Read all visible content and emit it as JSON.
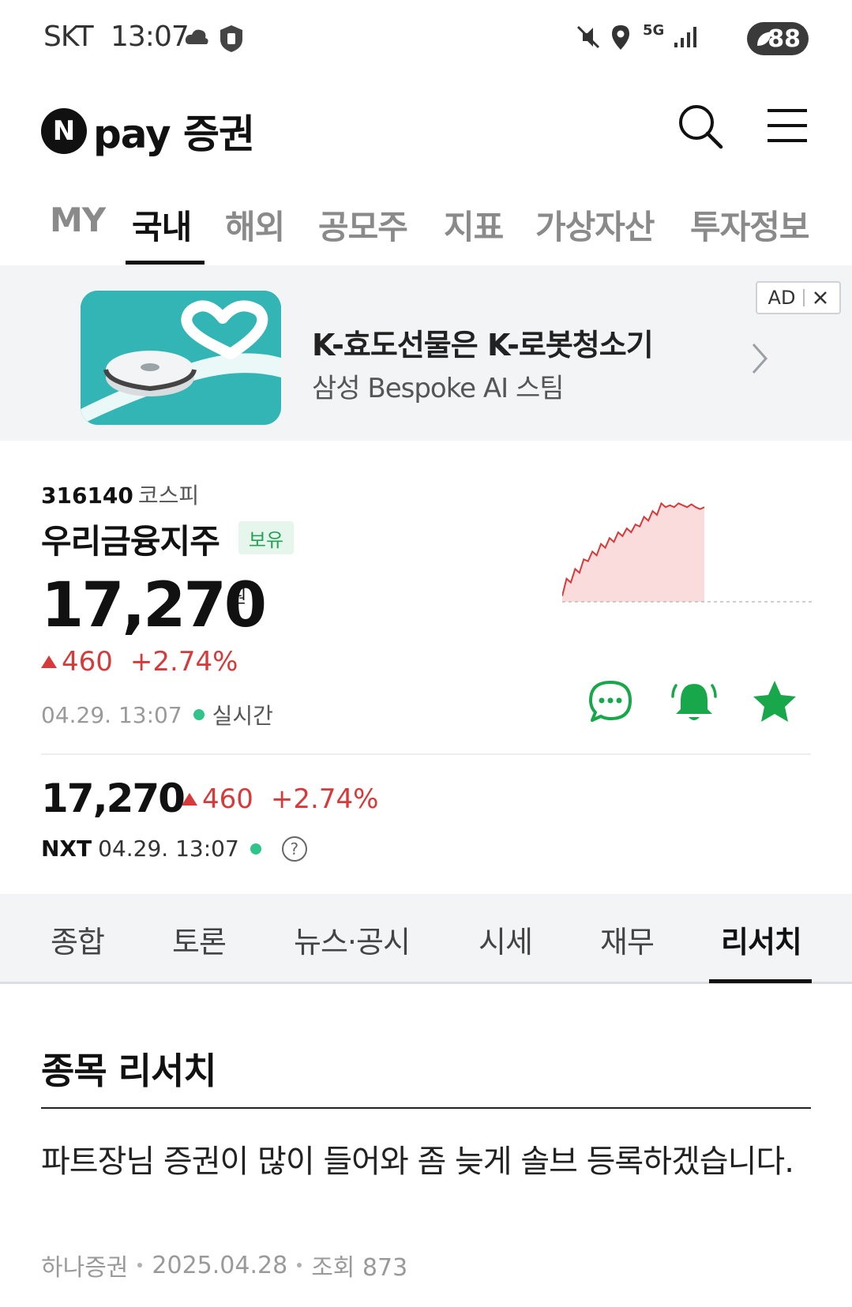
{
  "status_bar": {
    "carrier": "SKT",
    "time": "13:07",
    "network": "5G",
    "battery": "88"
  },
  "header": {
    "logo_mark": "N",
    "logo_text": "pay 증권",
    "icons": [
      "search-icon",
      "menu-icon"
    ]
  },
  "main_tabs": [
    {
      "label": "MY"
    },
    {
      "label": "국내",
      "active": true
    },
    {
      "label": "해외"
    },
    {
      "label": "공모주"
    },
    {
      "label": "지표"
    },
    {
      "label": "가상자산"
    },
    {
      "label": "투자정보"
    }
  ],
  "ad": {
    "title": "K-효도선물은 K-로봇청소기",
    "subtitle": "삼성 Bespoke AI 스팀",
    "badge": "AD"
  },
  "stock": {
    "code": "316140",
    "market": "코스피",
    "name": "우리금융지주",
    "holding_badge": "보유",
    "price": "17,270",
    "unit": "원",
    "change": "460",
    "change_pct": "+2.74%",
    "timestamp": "04.29. 13:07",
    "live_label": "실시간"
  },
  "nxt": {
    "price": "17,270",
    "change": "460",
    "change_pct": "+2.74%",
    "label": "NXT",
    "timestamp": "04.29. 13:07"
  },
  "sub_tabs": [
    {
      "label": "종합"
    },
    {
      "label": "토론"
    },
    {
      "label": "뉴스·공시"
    },
    {
      "label": "시세"
    },
    {
      "label": "재무"
    },
    {
      "label": "리서치",
      "active": true
    }
  ],
  "research": {
    "section_title": "종목 리서치",
    "article_title": "파트장님 증권이 많이 들어와 좀 늦게 솔브 등록하겠습니다.",
    "source": "하나증권",
    "date": "2025.04.28",
    "views": "조회 873"
  },
  "colors": {
    "up": "#d63a3a",
    "brand_green": "#18a74a",
    "live": "#2ec48a"
  },
  "chart_data": {
    "type": "area",
    "series": [
      {
        "values": [
          16810,
          16900,
          16880,
          16950,
          16930,
          17000,
          16990,
          17040,
          17020,
          17080,
          17060,
          17110,
          17090,
          17140,
          17120,
          17160,
          17140,
          17180,
          17170,
          17220,
          17200,
          17250,
          17230,
          17290,
          17270,
          17280,
          17270,
          17290,
          17280,
          17270,
          17285,
          17270,
          17260,
          17270
        ]
      }
    ],
    "baseline": 16810,
    "ylim": [
      16780,
      17320
    ]
  }
}
